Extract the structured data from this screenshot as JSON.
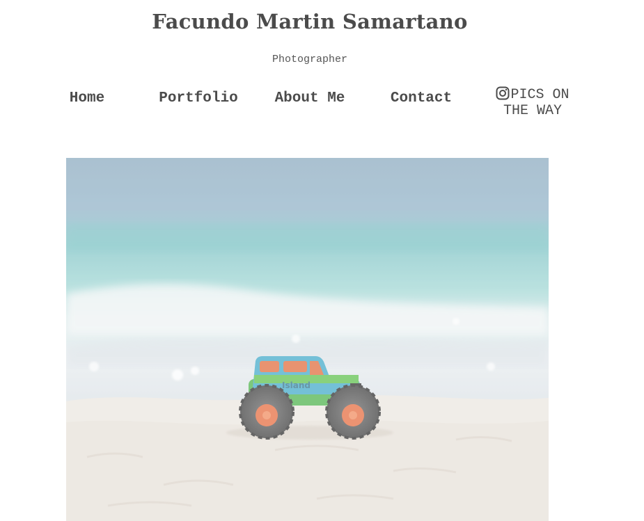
{
  "header": {
    "title": "Facundo Martin Samartano",
    "subtitle": "Photographer"
  },
  "nav": {
    "items": [
      {
        "label": "Home"
      },
      {
        "label": "Portfolio"
      },
      {
        "label": "About Me"
      },
      {
        "label": "Contact"
      }
    ],
    "instagram": {
      "icon": "instagram-icon",
      "label_line1": "PICS ON",
      "label_line2": "THE WAY"
    }
  },
  "hero": {
    "toy_text": "Island"
  },
  "colors": {
    "text": "#4b4b4b",
    "sea_top": "#8fb0c6",
    "sea_teal": "#8fd3cf",
    "sand": "#e9e3db",
    "toy_body": "#3fa8c8",
    "toy_green": "#5cc04a",
    "wheel_hub": "#e56a3c"
  }
}
